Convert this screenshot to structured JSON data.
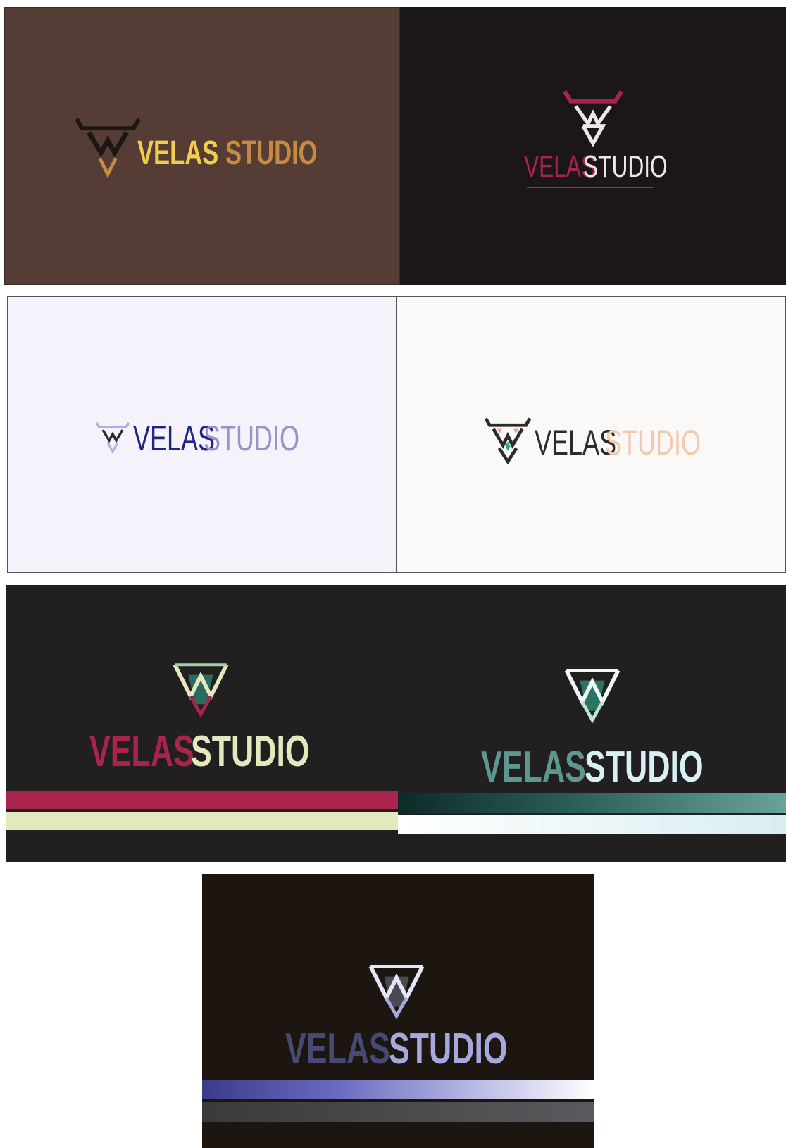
{
  "cards": [
    {
      "id": "brown",
      "word_a": "VELAS",
      "word_b": "STUDIO",
      "colors": {
        "bg": "#553c34",
        "a": "#f1cd4e",
        "b": "#c58a44",
        "mark_1": "#1c1614",
        "mark_2": "#c58a44"
      }
    },
    {
      "id": "black-red",
      "word_a": "VELAS",
      "word_b": "STUDIO",
      "colors": {
        "bg": "#1b1718",
        "a": "#a8244a",
        "b": "#ece8ea",
        "mark_1": "#a8244a",
        "mark_2": "#ece8ea"
      }
    },
    {
      "id": "lavender",
      "word_a": "VELAS",
      "word_b": "STUDIO",
      "colors": {
        "bg": "#f5f2fc",
        "a": "#1e2683",
        "b": "#9a93c8",
        "mark_1": "#2a2a2a",
        "mark_2": "#b7acdf"
      }
    },
    {
      "id": "cream",
      "word_a": "VELAS",
      "word_b": "STUDIO",
      "colors": {
        "bg": "#faf9f7",
        "a": "#2c2c2c",
        "b": "#f4c9ae",
        "mark_1": "#2c2c2c",
        "mark_2": "#e6a182"
      }
    },
    {
      "id": "dark-red-cream",
      "word_a": "VELAS",
      "word_b": "STUDIO",
      "colors": {
        "bg": "#211f20",
        "a": "#a8244a",
        "b": "#e3e8bf",
        "mark_1": "#e3e8bf",
        "mark_2": "#2a7466"
      }
    },
    {
      "id": "dark-teal",
      "word_a": "VELAS",
      "word_b": "STUDIO",
      "colors": {
        "bg": "#211f20",
        "a": "#5e9690",
        "b": "#d8eff3",
        "mark_1": "#eef6f6",
        "mark_2": "#2a7466"
      }
    },
    {
      "id": "dark-violet",
      "word_a": "VELAS",
      "word_b": "STUDIO",
      "colors": {
        "bg": "#1d150f",
        "a": "#474a72",
        "b": "#a6a8e0",
        "mark_1": "#e6e6f6",
        "mark_2": "#5a5a60"
      }
    }
  ]
}
